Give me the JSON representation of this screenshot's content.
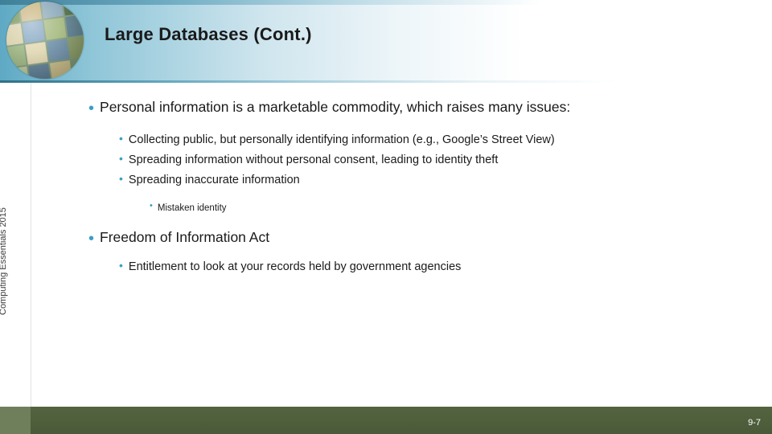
{
  "slide": {
    "title": "Large Databases (Cont.)",
    "page_number": "9-7",
    "side_label": "Computing Essentials 2015",
    "accent_color": "#3b9ec4",
    "bottom_band_color": "#4b5a3e",
    "bullet_glyph": "•"
  },
  "body": {
    "blocks": [
      {
        "level": 1,
        "text": "Personal information is a marketable commodity, which raises many issues:"
      },
      {
        "level": 2,
        "text": "Collecting public, but personally identifying information (e.g., Google’s Street View)"
      },
      {
        "level": 2,
        "text": "Spreading information without personal consent, leading to identity theft"
      },
      {
        "level": 2,
        "text": "Spreading inaccurate information"
      },
      {
        "level": 3,
        "text": "Mistaken identity"
      },
      {
        "level": 1,
        "text": "Freedom of Information Act"
      },
      {
        "level": 2,
        "text": "Entitlement to look at your records held by government agencies"
      }
    ]
  }
}
